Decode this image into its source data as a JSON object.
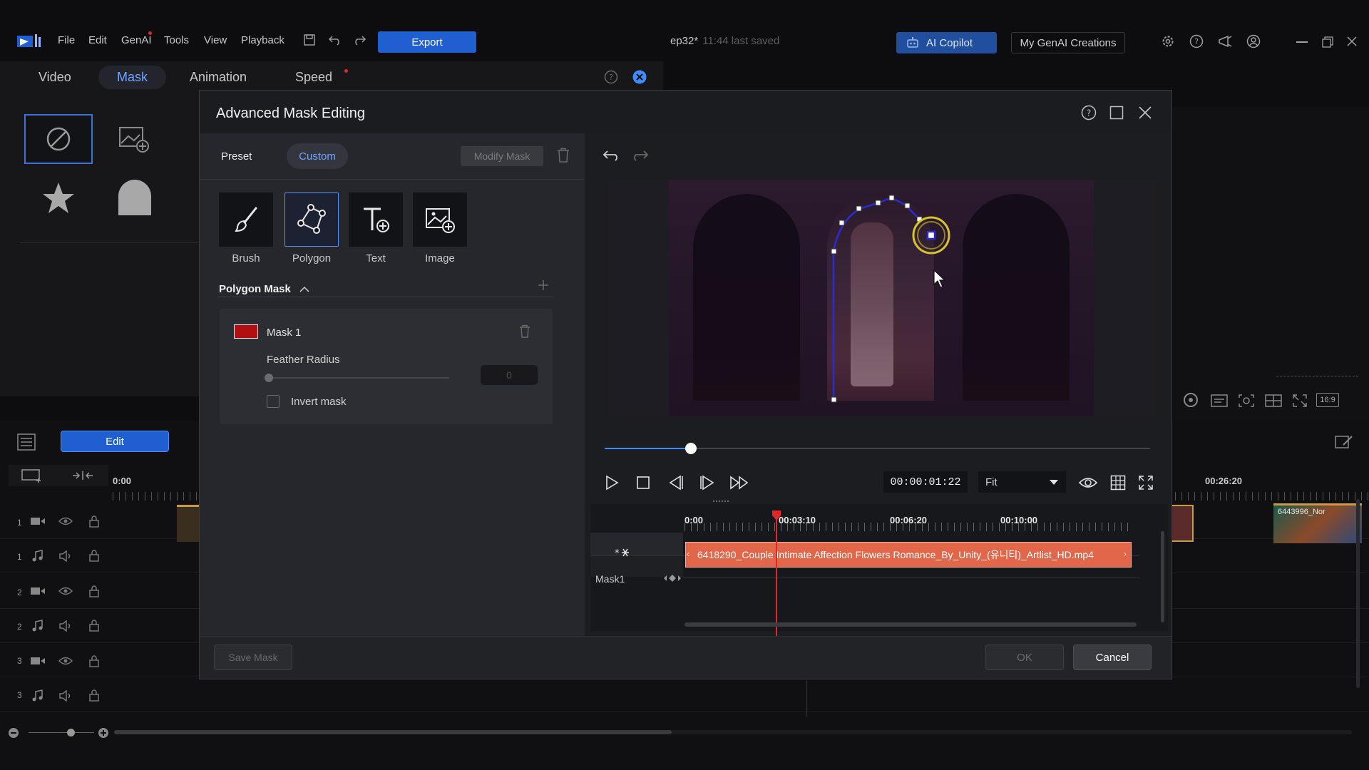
{
  "menu": {
    "items": [
      "File",
      "Edit",
      "GenAI",
      "Tools",
      "View",
      "Playback"
    ],
    "export_label": "Export",
    "project_name": "ep32*",
    "save_status": "11:44 last saved",
    "ai_copilot_label": "AI Copilot",
    "creations_label": "My GenAI Creations"
  },
  "bg_panel": {
    "tabs": [
      "Video",
      "Mask",
      "Animation",
      "Speed"
    ],
    "active_tab": "Mask",
    "edit_label": "Edit",
    "timeline_start": "0:00",
    "timeline_right": "00:26:20",
    "right_clip_label": "6443996_Nor",
    "aspect_label": "16:9",
    "track_numbers": [
      "1",
      "1",
      "2",
      "2",
      "3",
      "3"
    ]
  },
  "dialog": {
    "title": "Advanced Mask Editing",
    "preset_label": "Preset",
    "custom_label": "Custom",
    "modify_mask_label": "Modify Mask",
    "tools": [
      {
        "label": "Brush",
        "icon": "brush-icon"
      },
      {
        "label": "Polygon",
        "icon": "polygon-icon"
      },
      {
        "label": "Text",
        "icon": "text-add-icon"
      },
      {
        "label": "Image",
        "icon": "image-add-icon"
      }
    ],
    "active_tool": "Polygon",
    "section_title": "Polygon Mask",
    "mask": {
      "name": "Mask 1",
      "color": "#b30f10",
      "feather_label": "Feather Radius",
      "feather_value": "0",
      "invert_label": "Invert mask",
      "invert_checked": false
    },
    "timecode": "00:00:01:22",
    "zoom_fit": "Fit",
    "seek_fraction": 0.16,
    "ruler": [
      "0:00",
      "00:03:10",
      "00:06:20",
      "00:10:00"
    ],
    "clip_name": "6418290_Couple Intimate Affection Flowers Romance_By_Unity_(유니티)_Artlist_HD.mp4",
    "mask_track_label": "Mask1",
    "save_mask_label": "Save Mask",
    "ok_label": "OK",
    "cancel_label": "Cancel"
  },
  "colors": {
    "accent": "#3f8cff",
    "clip": "#e2674a",
    "playhead": "#e12727",
    "mask_outline": "#2b2bd6"
  }
}
